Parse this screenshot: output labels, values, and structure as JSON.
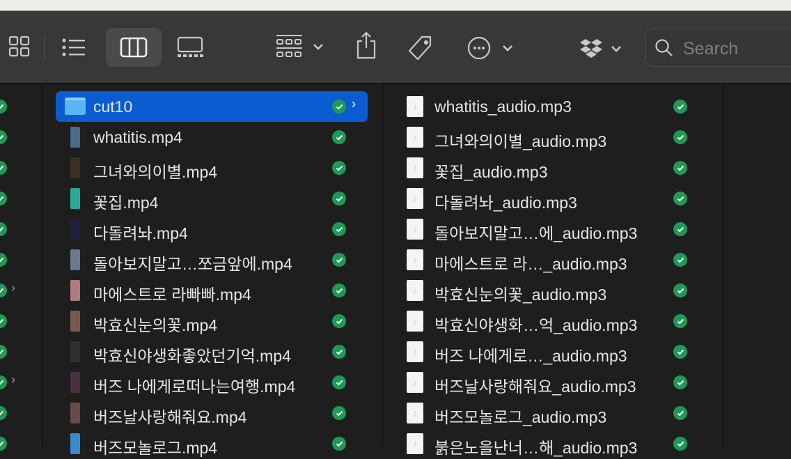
{
  "toolbar": {
    "search_placeholder": "Search"
  },
  "column2": {
    "items": [
      {
        "name": "cut10",
        "type": "folder",
        "selected": true
      },
      {
        "name": "whatitis.mp4",
        "thumb": "#4a6a8a"
      },
      {
        "name": "그녀와의이별.mp4",
        "thumb": "#3a3020"
      },
      {
        "name": "꽃집.mp4",
        "thumb": "#2aa89a"
      },
      {
        "name": "다돌려놔.mp4",
        "thumb": "#202040"
      },
      {
        "name": "돌아보지말고…쪼금앞에.mp4",
        "thumb": "#6a7890"
      },
      {
        "name": "마에스트로 라빠빠.mp4",
        "thumb": "#b07a80"
      },
      {
        "name": "박효신눈의꽃.mp4",
        "thumb": "#7a5a50"
      },
      {
        "name": "박효신야생화좋았던기억.mp4",
        "thumb": "#303030"
      },
      {
        "name": "버즈 나에게로떠나는여행.mp4",
        "thumb": "#4a3040"
      },
      {
        "name": "버즈날사랑해줘요.mp4",
        "thumb": "#6a4a4a"
      },
      {
        "name": "버즈모놀로그.mp4",
        "thumb": "#3a8ad0"
      }
    ]
  },
  "column3": {
    "items": [
      "whatitis_audio.mp3",
      "그녀와의이별_audio.mp3",
      "꽃집_audio.mp3",
      "다돌려놔_audio.mp3",
      "돌아보지말고…에_audio.mp3",
      "마에스트로 라…_audio.mp3",
      "박효신눈의꽃_audio.mp3",
      "박효신야생화…억_audio.mp3",
      "버즈 나에게로…_audio.mp3",
      "버즈날사랑해줘요_audio.mp3",
      "버즈모놀로그_audio.mp3",
      "붉은노을난너…해_audio.mp3"
    ]
  },
  "colors": {
    "accent": "#0a5dd0",
    "synced": "#1f9a55"
  }
}
